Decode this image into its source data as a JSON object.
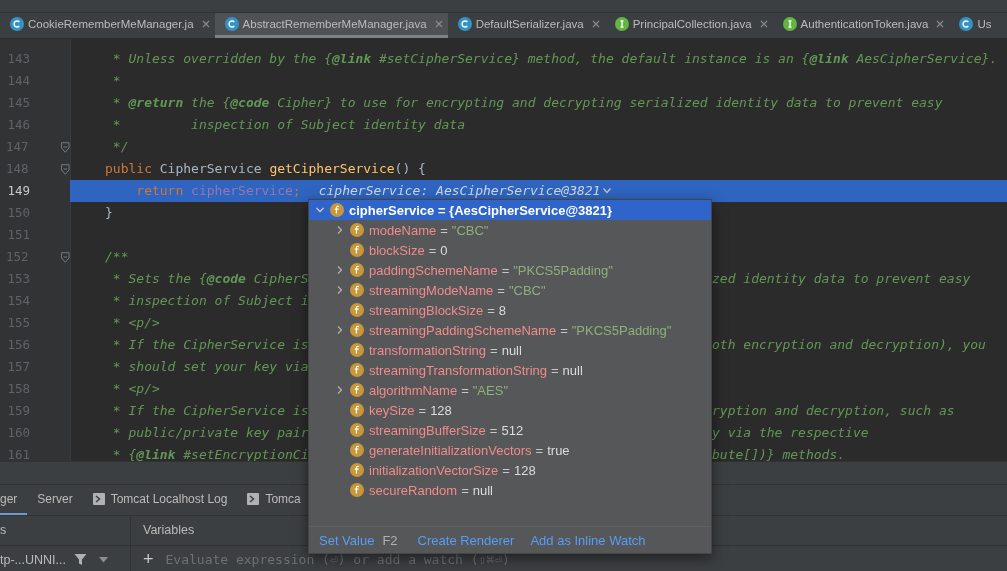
{
  "tabs": [
    {
      "label": "CookieRememberMeManager.ja",
      "kind": "class",
      "selected": false
    },
    {
      "label": "AbstractRememberMeManager.java",
      "kind": "class",
      "selected": true
    },
    {
      "label": "DefaultSerializer.java",
      "kind": "class",
      "selected": false
    },
    {
      "label": "PrincipalCollection.java",
      "kind": "interface",
      "selected": false
    },
    {
      "label": "AuthenticationToken.java",
      "kind": "interface",
      "selected": false
    },
    {
      "label": "Us",
      "kind": "class",
      "selected": false
    }
  ],
  "editor": {
    "lines": [
      {
        "number": "143",
        "fold": false,
        "current": false,
        "parts": [
          {
            "kind": "comment",
            "text": " * Unless overridden by the {**@link** #setCipherService} method, the default instance is an {**@link** AesCipherService}."
          }
        ]
      },
      {
        "number": "144",
        "fold": false,
        "current": false,
        "parts": [
          {
            "kind": "comment",
            "text": " *"
          }
        ]
      },
      {
        "number": "145",
        "fold": false,
        "current": false,
        "parts": [
          {
            "kind": "comment",
            "text": " * **@return** the {**@code** Cipher} to use for encrypting and decrypting serialized identity data to prevent easy"
          }
        ]
      },
      {
        "number": "146",
        "fold": false,
        "current": false,
        "parts": [
          {
            "kind": "comment",
            "text": " *         inspection of Subject identity data"
          }
        ]
      },
      {
        "number": "147",
        "fold": true,
        "current": false,
        "parts": [
          {
            "kind": "comment",
            "text": " */"
          }
        ]
      },
      {
        "number": "148",
        "fold": true,
        "current": false,
        "parts": [
          {
            "kind": "keyword",
            "text": "public "
          },
          {
            "kind": "plain",
            "text": "CipherService "
          },
          {
            "kind": "method",
            "text": "getCipherService"
          },
          {
            "kind": "plain",
            "text": "() {"
          }
        ]
      },
      {
        "number": "149",
        "fold": false,
        "current": true,
        "parts": [
          {
            "kind": "keyword",
            "text": "    return "
          },
          {
            "kind": "field",
            "text": "cipherService"
          },
          {
            "kind": "keyword",
            "text": ";"
          },
          {
            "kind": "hint",
            "text": "cipherService: AesCipherService@3821"
          }
        ]
      },
      {
        "number": "150",
        "fold": false,
        "current": false,
        "parts": [
          {
            "kind": "plain",
            "text": "}"
          }
        ]
      },
      {
        "number": "151",
        "fold": false,
        "current": false
      },
      {
        "number": "152",
        "fold": true,
        "current": false,
        "parts": [
          {
            "kind": "comment",
            "text": "/**"
          }
        ]
      },
      {
        "number": "153",
        "fold": false,
        "current": false,
        "parts": [
          {
            "kind": "comment",
            "text": " * Sets the {**@code** CipherS"
          }
        ],
        "tail": "zed identity data to prevent easy"
      },
      {
        "number": "154",
        "fold": false,
        "current": false,
        "parts": [
          {
            "kind": "comment",
            "text": " * inspection of Subject i"
          }
        ]
      },
      {
        "number": "155",
        "fold": false,
        "current": false,
        "parts": [
          {
            "kind": "comment",
            "text": " * <p/>"
          }
        ]
      },
      {
        "number": "156",
        "fold": false,
        "current": false,
        "parts": [
          {
            "kind": "comment",
            "text": " * If the CipherService is"
          }
        ],
        "tail": "oth encryption and decryption), you"
      },
      {
        "number": "157",
        "fold": false,
        "current": false,
        "parts": [
          {
            "kind": "comment",
            "text": " * should set your key via"
          }
        ]
      },
      {
        "number": "158",
        "fold": false,
        "current": false,
        "parts": [
          {
            "kind": "comment",
            "text": " * <p/>"
          }
        ]
      },
      {
        "number": "159",
        "fold": false,
        "current": false,
        "parts": [
          {
            "kind": "comment",
            "text": " * If the CipherService is"
          }
        ],
        "tail": "ryption and decryption, such as"
      },
      {
        "number": "160",
        "fold": false,
        "current": false,
        "parts": [
          {
            "kind": "comment",
            "text": " * public/private key pair"
          }
        ],
        "tail": "y via the respective"
      },
      {
        "number": "161",
        "fold": false,
        "current": false,
        "parts": [
          {
            "kind": "comment",
            "text": " * {**@link** #setEncryptionCi"
          }
        ],
        "tail": "bute[])} methods."
      }
    ]
  },
  "popup": {
    "root": {
      "name": "cipherService",
      "equals": "=",
      "value": "{AesCipherService@3821}",
      "expanded": true,
      "selected": true
    },
    "fields": [
      {
        "name": "modeName",
        "equals": "=",
        "value": "\"CBC\"",
        "kind": "string",
        "expandable": true
      },
      {
        "name": "blockSize",
        "equals": "=",
        "value": "0",
        "kind": "plain",
        "expandable": false
      },
      {
        "name": "paddingSchemeName",
        "equals": "=",
        "value": "\"PKCS5Padding\"",
        "kind": "string",
        "expandable": true
      },
      {
        "name": "streamingModeName",
        "equals": "=",
        "value": "\"CBC\"",
        "kind": "string",
        "expandable": true
      },
      {
        "name": "streamingBlockSize",
        "equals": "=",
        "value": "8",
        "kind": "plain",
        "expandable": false
      },
      {
        "name": "streamingPaddingSchemeName",
        "equals": "=",
        "value": "\"PKCS5Padding\"",
        "kind": "string",
        "expandable": true
      },
      {
        "name": "transformationString",
        "equals": "=",
        "value": "null",
        "kind": "plain",
        "expandable": false
      },
      {
        "name": "streamingTransformationString",
        "equals": "=",
        "value": "null",
        "kind": "plain",
        "expandable": false
      },
      {
        "name": "algorithmName",
        "equals": "=",
        "value": "\"AES\"",
        "kind": "string",
        "expandable": true
      },
      {
        "name": "keySize",
        "equals": "=",
        "value": "128",
        "kind": "plain",
        "expandable": false
      },
      {
        "name": "streamingBufferSize",
        "equals": "=",
        "value": "512",
        "kind": "plain",
        "expandable": false
      },
      {
        "name": "generateInitializationVectors",
        "equals": "=",
        "value": "true",
        "kind": "plain",
        "expandable": false
      },
      {
        "name": "initializationVectorSize",
        "equals": "=",
        "value": "128",
        "kind": "plain",
        "expandable": false
      },
      {
        "name": "secureRandom",
        "equals": "=",
        "value": "null",
        "kind": "plain",
        "expandable": false
      }
    ],
    "actions": [
      {
        "label": "Set Value",
        "shortcut": "F2"
      },
      {
        "label": "Create Renderer"
      },
      {
        "label": "Add as Inline Watch"
      }
    ]
  },
  "bottom_panel": {
    "tabs": [
      {
        "label": "ger",
        "console": false,
        "selected": true
      },
      {
        "label": "Server",
        "console": false,
        "selected": false
      },
      {
        "label": "Tomcat Localhost Log",
        "console": true,
        "selected": false
      },
      {
        "label": "Tomca",
        "console": true,
        "selected": false
      }
    ],
    "frames_header": "s",
    "variables_header": "Variables",
    "thread": "tp-...UNNI...",
    "evaluate": {
      "placeholder": "Evaluate expression (⏎) or add a watch (⇧⌘⏎)"
    },
    "add": "+"
  }
}
